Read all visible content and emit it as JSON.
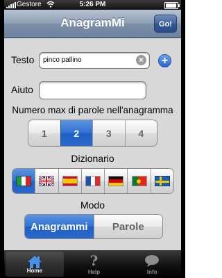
{
  "status_bar": {
    "carrier": "Gestore",
    "time": "5:26 PM"
  },
  "nav": {
    "title": "AnagramMi",
    "go_label": "Go!"
  },
  "form": {
    "testo_label": "Testo",
    "testo_value": "pinco pallino",
    "aiuto_label": "Aiuto",
    "aiuto_value": "",
    "words_label": "Numero max di parole nell'anagramma",
    "words_options": [
      "1",
      "2",
      "3",
      "4"
    ],
    "words_selected": "2",
    "dict_label": "Dizionario",
    "dict_options": [
      "italian",
      "english",
      "spanish",
      "french",
      "german",
      "portuguese",
      "swedish"
    ],
    "dict_selected": "italian",
    "mode_label": "Modo",
    "mode_options": [
      "Anagrammi",
      "Parole"
    ],
    "mode_selected": "Anagrammi"
  },
  "tabs": [
    {
      "label": "Home",
      "icon": "home-icon",
      "active": true
    },
    {
      "label": "Help",
      "icon": "question-icon",
      "active": false
    },
    {
      "label": "Info",
      "icon": "speech-bubble-icon",
      "active": false
    }
  ],
  "colors": {
    "nav_bar": "#8c9db3",
    "selected_segment": "#2f70d2",
    "background": "#d8d8d8"
  }
}
